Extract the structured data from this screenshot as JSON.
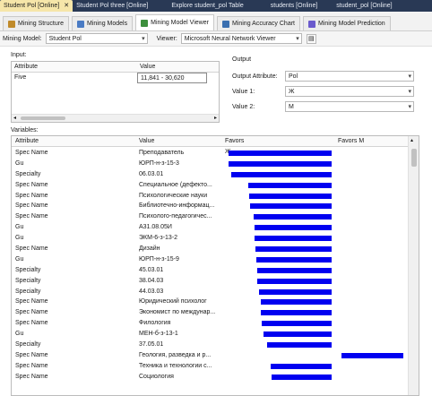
{
  "document_tabs": [
    {
      "label": "Student Pol [Online]",
      "active": true,
      "close": "✕"
    },
    {
      "label": "Student Pol three [Online]",
      "active": false
    },
    {
      "label": "Explore student_pol Table",
      "active": false
    },
    {
      "label": "students [Online]",
      "active": false
    },
    {
      "label": "student_pol [Online]",
      "active": false
    }
  ],
  "view_tabs": [
    {
      "label": "Mining Structure",
      "icon": "structure-icon",
      "color": "#c08a2a"
    },
    {
      "label": "Mining Models",
      "icon": "models-icon",
      "color": "#4a7bc4"
    },
    {
      "label": "Mining Model Viewer",
      "icon": "viewer-icon",
      "color": "#3d8f3d",
      "active": true
    },
    {
      "label": "Mining Accuracy Chart",
      "icon": "accuracy-chart-icon",
      "color": "#3a6fb0"
    },
    {
      "label": "Mining Model Prediction",
      "icon": "prediction-icon",
      "color": "#6a5acd"
    }
  ],
  "model_bar": {
    "mining_model_label": "Mining Model:",
    "mining_model_value": "Student Pol",
    "viewer_label": "Viewer:",
    "viewer_value": "Microsoft Neural Network Viewer"
  },
  "input": {
    "section_label": "Input:",
    "headers": [
      "Attribute",
      "Value"
    ],
    "rows": [
      {
        "attribute": "Five",
        "value": "11,841 - 30,620"
      }
    ]
  },
  "output": {
    "section_label": "Output",
    "attribute_label": "Output Attribute:",
    "attribute_value": "Pol",
    "value1_label": "Value 1:",
    "value1_value": "Ж",
    "value2_label": "Value 2:",
    "value2_value": "М"
  },
  "variables": {
    "section_label": "Variables:",
    "headers": {
      "attribute": "Attribute",
      "value": "Value",
      "favors1": "Favors Ж",
      "favors2": "Favors М"
    },
    "bar_color": "#0000f0",
    "rows": [
      {
        "attribute": "Spec Name",
        "value": "Преподаватель",
        "favors": "Ж",
        "score": 1.0
      },
      {
        "attribute": "Gu",
        "value": "ЮРП-н-з-15-3",
        "favors": "Ж",
        "score": 1.0
      },
      {
        "attribute": "Specialty",
        "value": "06.03.01",
        "favors": "Ж",
        "score": 0.97
      },
      {
        "attribute": "Spec Name",
        "value": "Специальное (дефекто...",
        "favors": "Ж",
        "score": 0.81
      },
      {
        "attribute": "Spec Name",
        "value": "Психологические науки",
        "favors": "Ж",
        "score": 0.8
      },
      {
        "attribute": "Spec Name",
        "value": "Библиотечно-информац...",
        "favors": "Ж",
        "score": 0.79
      },
      {
        "attribute": "Spec Name",
        "value": "Психолого-педагогичес...",
        "favors": "Ж",
        "score": 0.76
      },
      {
        "attribute": "Gu",
        "value": "А31.08.05И",
        "favors": "Ж",
        "score": 0.75
      },
      {
        "attribute": "Gu",
        "value": "ЭКМ-6-з-13-2",
        "favors": "Ж",
        "score": 0.75
      },
      {
        "attribute": "Spec Name",
        "value": "Дизайн",
        "favors": "Ж",
        "score": 0.74
      },
      {
        "attribute": "Gu",
        "value": "ЮРП-н-з-15-9",
        "favors": "Ж",
        "score": 0.73
      },
      {
        "attribute": "Specialty",
        "value": "45.03.01",
        "favors": "Ж",
        "score": 0.72
      },
      {
        "attribute": "Specialty",
        "value": "38.04.03",
        "favors": "Ж",
        "score": 0.72
      },
      {
        "attribute": "Specialty",
        "value": "44.03.03",
        "favors": "Ж",
        "score": 0.7
      },
      {
        "attribute": "Spec Name",
        "value": "Юридический психолог",
        "favors": "Ж",
        "score": 0.69
      },
      {
        "attribute": "Spec Name",
        "value": "Экономист по междунар...",
        "favors": "Ж",
        "score": 0.69
      },
      {
        "attribute": "Spec Name",
        "value": "Филология",
        "favors": "Ж",
        "score": 0.68
      },
      {
        "attribute": "Gu",
        "value": "МЕН-б-з-13-1",
        "favors": "Ж",
        "score": 0.66
      },
      {
        "attribute": "Specialty",
        "value": "37.05.01",
        "favors": "Ж",
        "score": 0.63
      },
      {
        "attribute": "Spec Name",
        "value": "Геология, разведка и р...",
        "favors": "М",
        "score": 0.6
      },
      {
        "attribute": "Spec Name",
        "value": "Техника и технологии с...",
        "favors": "Ж",
        "score": 0.59
      },
      {
        "attribute": "Spec Name",
        "value": "Социология",
        "favors": "Ж",
        "score": 0.58
      }
    ]
  }
}
